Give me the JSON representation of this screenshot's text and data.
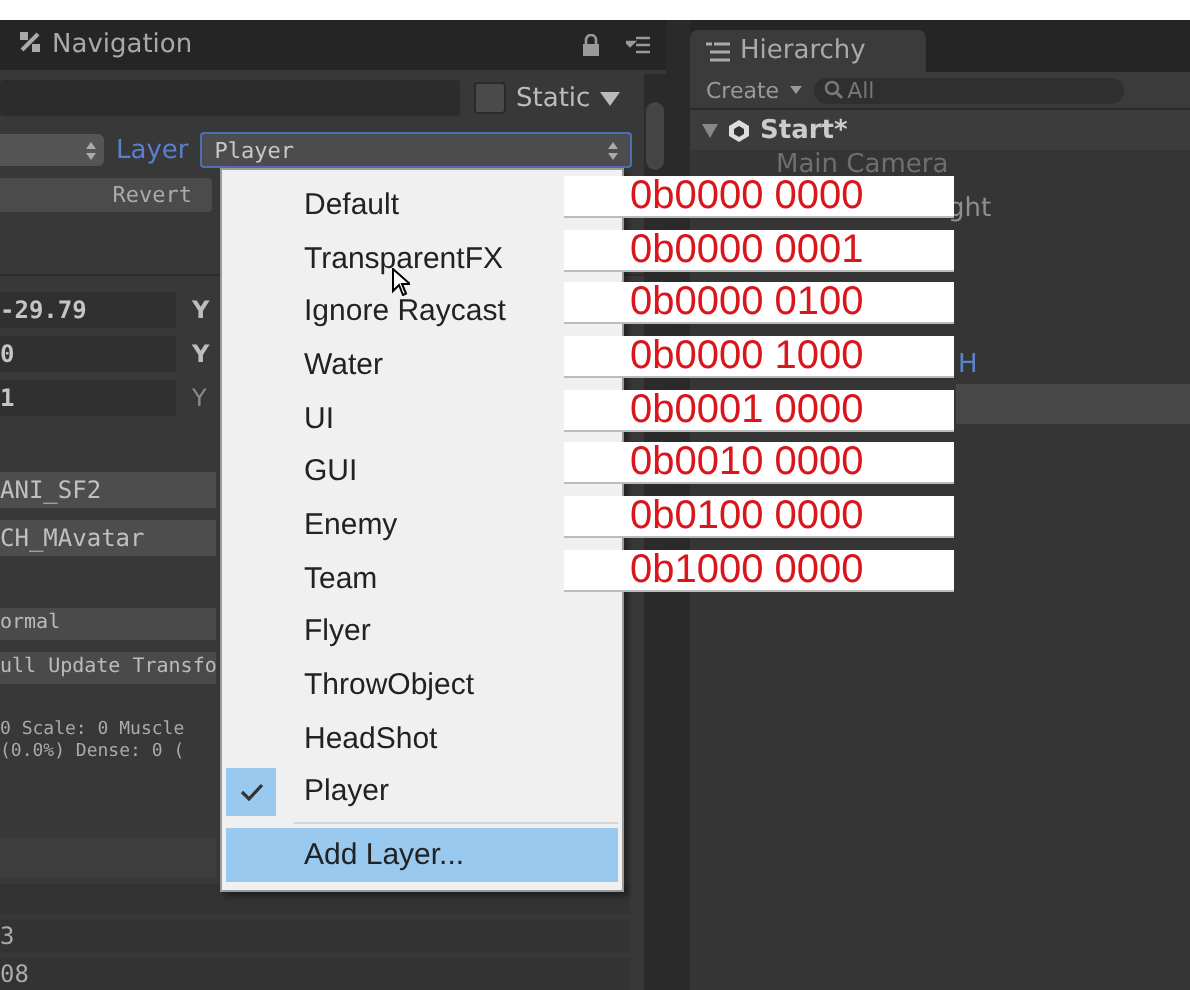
{
  "inspector": {
    "tab": "Navigation",
    "static_label": "Static",
    "static_checked": false,
    "layer_label": "Layer",
    "layer_value": "Player",
    "revert": "Revert",
    "transform": [
      {
        "value": "-29.79",
        "axis": "Y",
        "dim": false
      },
      {
        "value": "0",
        "axis": "Y",
        "dim": false
      },
      {
        "value": "1",
        "axis": "Y",
        "dim": true
      }
    ],
    "fields": [
      "ANI_SF2",
      "CH_MAvatar"
    ],
    "dropdowns": [
      "ormal",
      "ull Update Transfo"
    ],
    "info": [
      "0 Scale: 0 Muscle",
      "(0.0%) Dense: 0 ("
    ],
    "bottom_fields": [
      "3",
      "08"
    ]
  },
  "hierarchy": {
    "tab": "Hierarchy",
    "create": "Create",
    "search_placeholder": "All",
    "scene": "Start*",
    "items": [
      {
        "label": "Main Camera",
        "kind": "name",
        "selected": false
      },
      {
        "label": "ght",
        "kind": "fragment",
        "selected": false
      },
      {
        "label": "H",
        "kind": "prefab-fragment",
        "selected": false
      },
      {
        "kind": "empty",
        "selected": true
      }
    ]
  },
  "layer_menu": {
    "items": [
      {
        "label": "Default",
        "checked": false
      },
      {
        "label": "TransparentFX",
        "checked": false
      },
      {
        "label": "Ignore Raycast",
        "checked": false
      },
      {
        "label": "Water",
        "checked": false
      },
      {
        "label": "UI",
        "checked": false
      },
      {
        "label": "GUI",
        "checked": false
      },
      {
        "label": "Enemy",
        "checked": false
      },
      {
        "label": "Team",
        "checked": false
      },
      {
        "label": "Flyer",
        "checked": false
      },
      {
        "label": "ThrowObject",
        "checked": false
      },
      {
        "label": "HeadShot",
        "checked": false
      },
      {
        "label": "Player",
        "checked": true
      }
    ],
    "add_item": {
      "label": "Add Layer...",
      "highlighted": true
    }
  },
  "annotations": [
    "0b0000 0000",
    "0b0000 0001",
    "0b0000 0100",
    "0b0000 1000",
    "0b0001 0000",
    "0b0010 0000",
    "0b0100 0000",
    "0b1000 0000"
  ]
}
